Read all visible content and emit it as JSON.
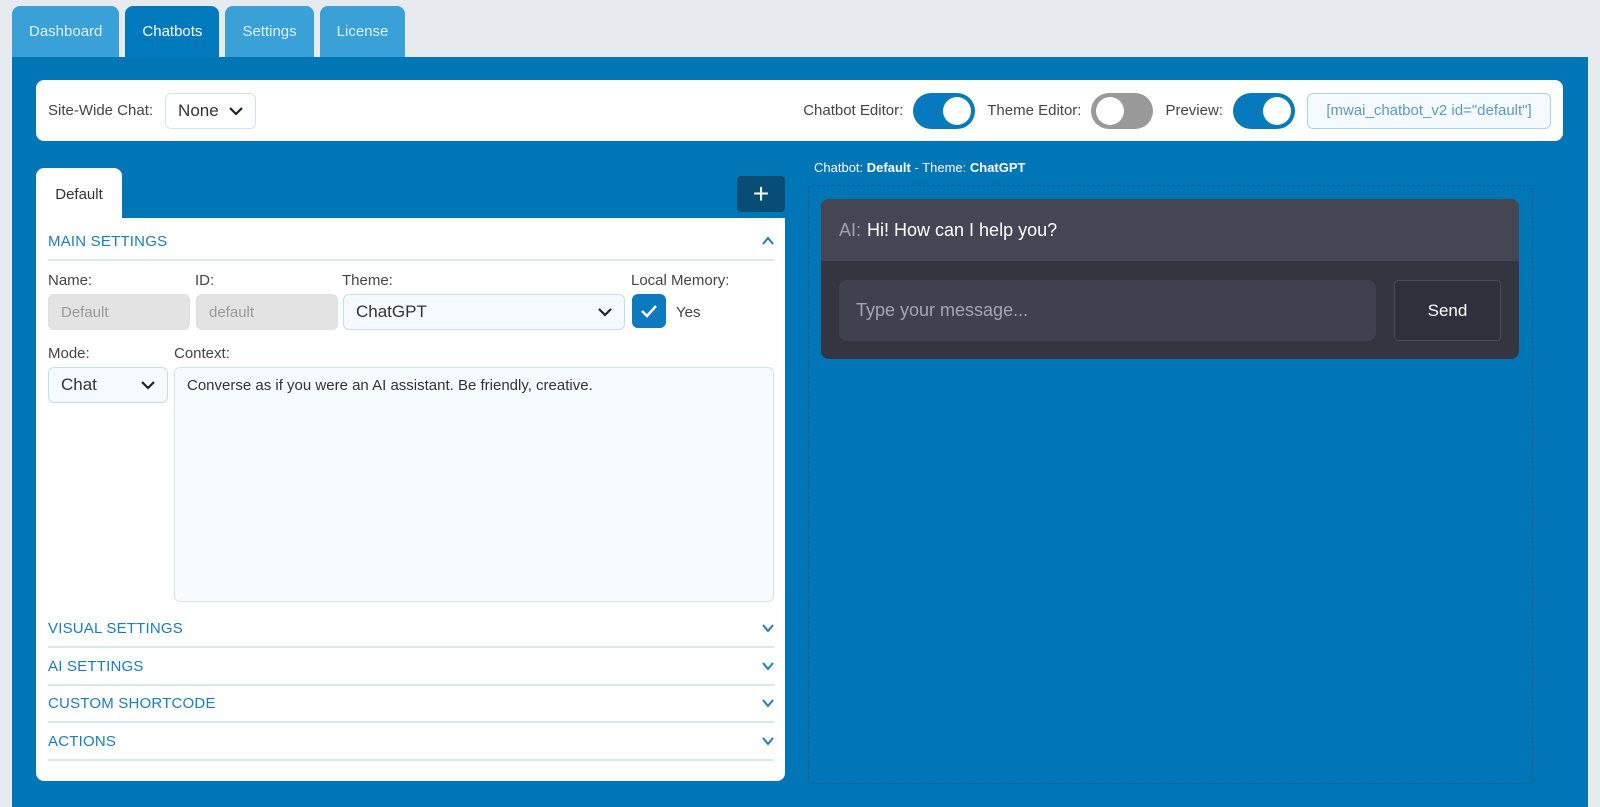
{
  "top_tabs": [
    {
      "label": "Dashboard",
      "active": false
    },
    {
      "label": "Chatbots",
      "active": true
    },
    {
      "label": "Settings",
      "active": false
    },
    {
      "label": "License",
      "active": false
    }
  ],
  "toolbar": {
    "site_wide_label": "Site-Wide Chat:",
    "site_wide_value": "None",
    "chatbot_editor_label": "Chatbot Editor:",
    "chatbot_editor_on": true,
    "theme_editor_label": "Theme Editor:",
    "theme_editor_on": false,
    "preview_label": "Preview:",
    "preview_on": true,
    "shortcode": "[mwai_chatbot_v2 id=\"default\"]"
  },
  "editor": {
    "tab_label": "Default",
    "add_label": "+",
    "sections": {
      "main": "MAIN SETTINGS",
      "visual": "VISUAL SETTINGS",
      "ai": "AI SETTINGS",
      "custom": "CUSTOM SHORTCODE",
      "actions": "ACTIONS"
    },
    "fields": {
      "name_label": "Name:",
      "name_placeholder": "Default",
      "id_label": "ID:",
      "id_placeholder": "default",
      "theme_label": "Theme:",
      "theme_value": "ChatGPT",
      "memory_label": "Local Memory:",
      "memory_text": "Yes",
      "memory_checked": true,
      "mode_label": "Mode:",
      "mode_value": "Chat",
      "context_label": "Context:",
      "context_value": "Converse as if you were an AI assistant. Be friendly, creative."
    }
  },
  "preview": {
    "title_prefix": "Chatbot:",
    "chatbot_name": "Default",
    "title_mid": "- Theme:",
    "theme_name": "ChatGPT",
    "ai_label": "AI:",
    "ai_message": "Hi! How can I help you?",
    "input_placeholder": "Type your message...",
    "send_label": "Send"
  },
  "colors": {
    "accent": "#0076b6",
    "tab_inactive": "#3aa0d8",
    "chat_bg": "#343541",
    "chat_msg_bg": "#444654"
  }
}
